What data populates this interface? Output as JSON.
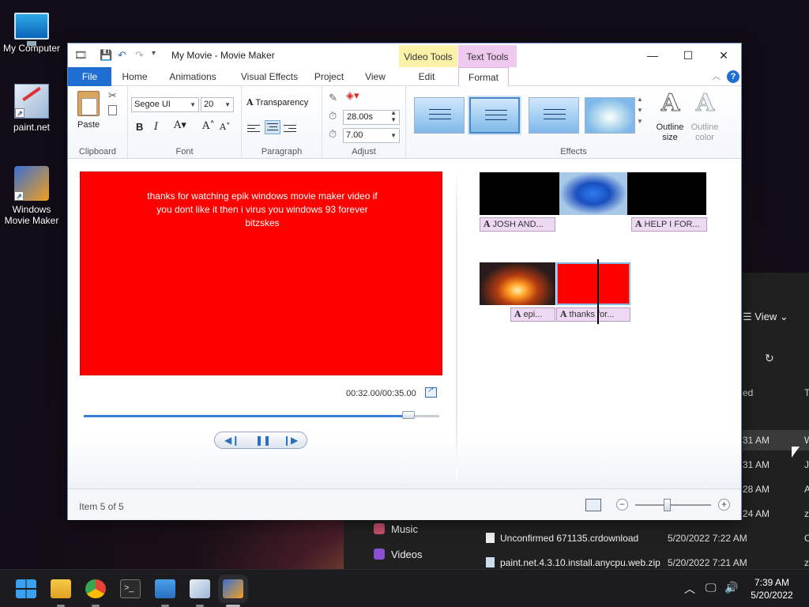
{
  "desktop": {
    "icons": [
      {
        "label": "My Computer"
      },
      {
        "label": "paint.net"
      },
      {
        "label": "Windows Movie Maker"
      }
    ]
  },
  "explorer": {
    "view_label": "View",
    "col_partial": "ed",
    "col_partial2": "T",
    "rows": [
      {
        "time": "31 AM",
        "type": "W"
      },
      {
        "time": "31 AM",
        "type": "JP"
      },
      {
        "time": "28 AM",
        "type": "A"
      },
      {
        "time": "24 AM",
        "type": "zi"
      }
    ],
    "nav": [
      {
        "label": "Music",
        "color": "#c0506a"
      },
      {
        "label": "Videos",
        "color": "#8a4fd0"
      }
    ],
    "files": [
      {
        "name": "Unconfirmed 671135.crdownload",
        "date": "5/20/2022 7:22 AM",
        "type": "C"
      },
      {
        "name": "paint.net.4.3.10.install.anycpu.web.zip",
        "date": "5/20/2022 7:21 AM",
        "type": "zi"
      }
    ]
  },
  "movie_maker": {
    "title": "My Movie - Movie Maker",
    "context_tabs": {
      "video": "Video Tools",
      "text": "Text Tools"
    },
    "tabs": [
      "File",
      "Home",
      "Animations",
      "Visual Effects",
      "Project",
      "View",
      "Edit",
      "Format"
    ],
    "clipboard": {
      "paste": "Paste",
      "group": "Clipboard"
    },
    "font": {
      "family": "Segoe UI",
      "size": "20",
      "group": "Font"
    },
    "paragraph": {
      "transparency": "Transparency",
      "group": "Paragraph"
    },
    "adjust": {
      "start_time": "28.00s",
      "duration": "7.00",
      "group": "Adjust"
    },
    "effects": {
      "group": "Effects",
      "outline_size": "Outline size",
      "outline_color": "Outline color"
    },
    "preview": {
      "text": "thanks for watching epik windows movie maker video if you dont like it then i virus you windows 93 forever bitzskes",
      "timecode": "00:32.00/00:35.00",
      "progress": 0.914
    },
    "storyboard": {
      "captions": [
        "JOSH AND...",
        "HELP I FOR...",
        "epi...",
        "thanks for..."
      ]
    },
    "status": {
      "item": "Item 5 of 5",
      "zoom": 0.42
    }
  },
  "taskbar": {
    "time": "7:39 AM",
    "date": "5/20/2022"
  }
}
